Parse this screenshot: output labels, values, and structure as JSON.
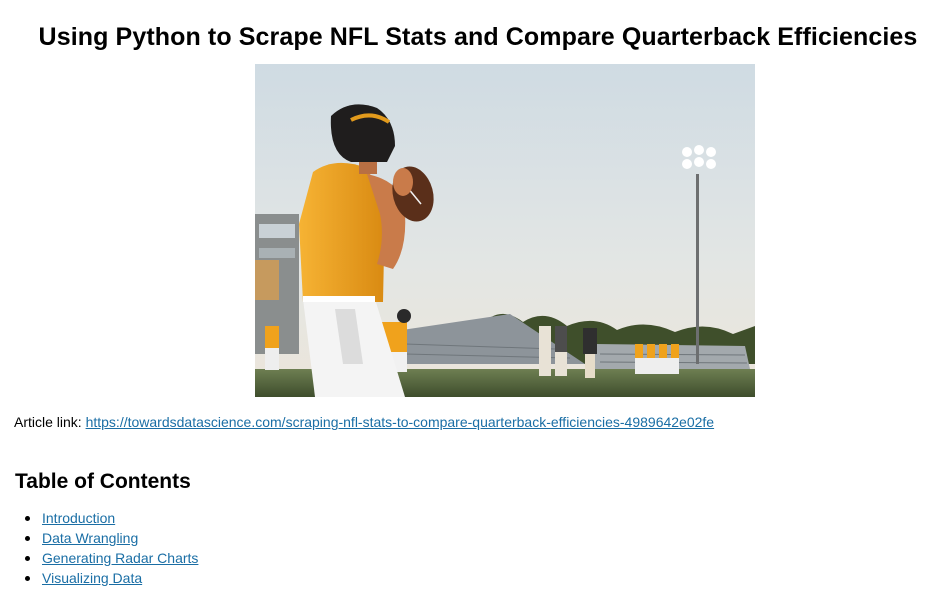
{
  "page": {
    "title": "Using Python to Scrape NFL Stats and Compare Quarterback Efficiencies"
  },
  "hero_image": {
    "icon": "football-quarterback-photo"
  },
  "article": {
    "label": "Article link: ",
    "url": "https://towardsdatascience.com/scraping-nfl-stats-to-compare-quarterback-efficiencies-4989642e02fe"
  },
  "toc": {
    "heading": "Table of Contents",
    "items": [
      {
        "label": "Introduction"
      },
      {
        "label": "Data Wrangling"
      },
      {
        "label": "Generating Radar Charts"
      },
      {
        "label": "Visualizing Data"
      }
    ]
  },
  "colors": {
    "link": "#1a6ea5",
    "text": "#000000",
    "jersey": "#f0a21c"
  }
}
